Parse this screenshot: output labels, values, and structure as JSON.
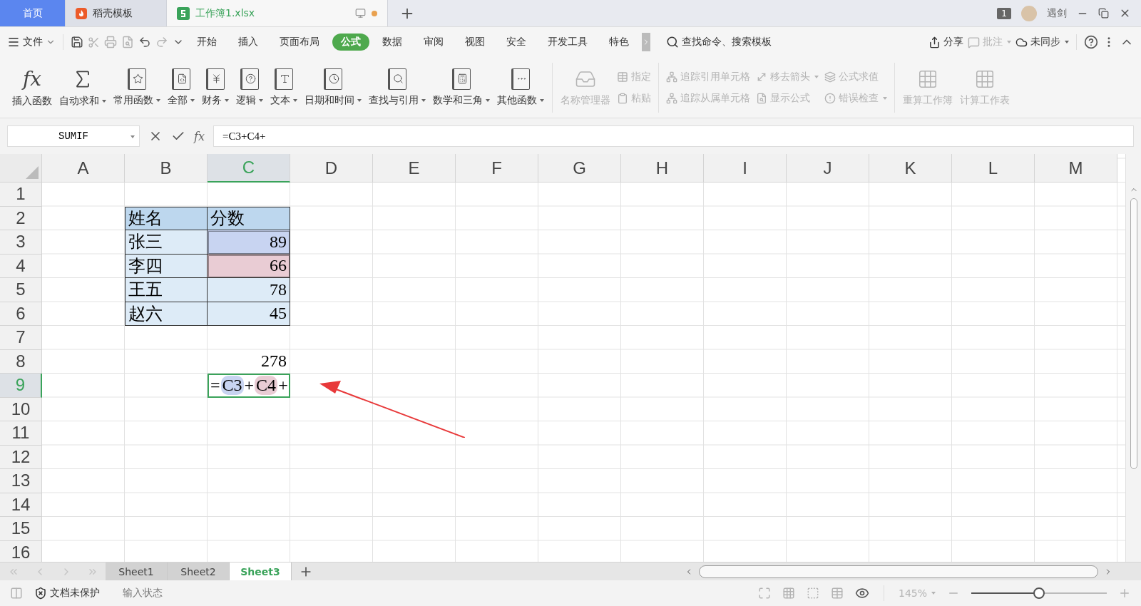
{
  "tabs": [
    {
      "label": "首页",
      "kind": "home",
      "selected": false
    },
    {
      "label": "稻壳模板",
      "kind": "docer",
      "selected": false
    },
    {
      "label": "工作簿1.xlsx",
      "kind": "sheet",
      "selected": true,
      "unsaved": true
    }
  ],
  "title_bar": {
    "badge": "1",
    "user": "遇剑"
  },
  "menu": {
    "file": "文件",
    "items": [
      {
        "label": "开始",
        "selected": false
      },
      {
        "label": "插入",
        "selected": false
      },
      {
        "label": "页面布局",
        "selected": false
      },
      {
        "label": "公式",
        "selected": true
      },
      {
        "label": "数据",
        "selected": false
      },
      {
        "label": "审阅",
        "selected": false
      },
      {
        "label": "视图",
        "selected": false
      },
      {
        "label": "安全",
        "selected": false
      },
      {
        "label": "开发工具",
        "selected": false
      },
      {
        "label": "特色",
        "selected": false
      }
    ],
    "search": "查找命令、搜索模板",
    "share": "分享",
    "comment": "批注",
    "sync": "未同步"
  },
  "ribbon": {
    "functions": [
      {
        "label": "插入函数",
        "kind": "fx",
        "glyph": "fx",
        "dropdown": false
      },
      {
        "label": "自动求和",
        "kind": "sigma",
        "dropdown": true
      },
      {
        "label": "常用函数",
        "kind": "star",
        "dropdown": true
      },
      {
        "label": "全部",
        "kind": "all",
        "dropdown": true
      },
      {
        "label": "财务",
        "kind": "yen",
        "dropdown": true
      },
      {
        "label": "逻辑",
        "kind": "help",
        "dropdown": true
      },
      {
        "label": "文本",
        "kind": "text",
        "dropdown": true
      },
      {
        "label": "日期和时间",
        "kind": "clock",
        "dropdown": true
      },
      {
        "label": "查找与引用",
        "kind": "search",
        "dropdown": true
      },
      {
        "label": "数学和三角",
        "kind": "math",
        "dropdown": true
      },
      {
        "label": "其他函数",
        "kind": "more",
        "dropdown": true
      }
    ],
    "names": {
      "big": {
        "label": "名称管理器",
        "disabled": true
      },
      "small": [
        {
          "label": "指定",
          "disabled": true
        },
        {
          "label": "粘贴",
          "disabled": true
        }
      ]
    },
    "audit": [
      {
        "label": "追踪引用单元格",
        "kind": "trace",
        "disabled": true,
        "dropdown": false
      },
      {
        "label": "追踪从属单元格",
        "kind": "dependents",
        "disabled": true,
        "dropdown": false
      },
      {
        "label": "移去箭头",
        "kind": "remove",
        "disabled": true,
        "dropdown": true
      },
      {
        "label": "显示公式",
        "kind": "show",
        "disabled": true,
        "dropdown": false
      },
      {
        "label": "公式求值",
        "kind": "evaluate",
        "disabled": true,
        "dropdown": false
      },
      {
        "label": "错误检查",
        "kind": "error",
        "disabled": true,
        "dropdown": true
      }
    ],
    "calc": [
      {
        "label": "重算工作簿",
        "disabled": true
      },
      {
        "label": "计算工作表",
        "disabled": true
      }
    ]
  },
  "formula_bar": {
    "name_box": "SUMIF",
    "fx": "fx",
    "formula": "=C3+C4+"
  },
  "sheet": {
    "columns": [
      {
        "label": "A",
        "selected": false
      },
      {
        "label": "B",
        "selected": false
      },
      {
        "label": "C",
        "selected": true
      },
      {
        "label": "D",
        "selected": false
      },
      {
        "label": "E",
        "selected": false
      },
      {
        "label": "F",
        "selected": false
      },
      {
        "label": "G",
        "selected": false
      },
      {
        "label": "H",
        "selected": false
      },
      {
        "label": "I",
        "selected": false
      },
      {
        "label": "J",
        "selected": false
      },
      {
        "label": "K",
        "selected": false
      },
      {
        "label": "L",
        "selected": false
      },
      {
        "label": "M",
        "selected": false
      }
    ],
    "rows": [
      {
        "label": "1",
        "selected": false
      },
      {
        "label": "2",
        "selected": false,
        "cells": {
          "B": {
            "kind": "head",
            "text": "姓名"
          },
          "C": {
            "kind": "head",
            "text": "分数"
          }
        }
      },
      {
        "label": "3",
        "selected": false,
        "cells": {
          "B": {
            "kind": "label",
            "text": "张三"
          },
          "C": {
            "kind": "value",
            "text": "89",
            "color": "#c8d4f1"
          }
        }
      },
      {
        "label": "4",
        "selected": false,
        "cells": {
          "B": {
            "kind": "label",
            "text": "李四"
          },
          "C": {
            "kind": "value",
            "text": "66",
            "color": "#e9ccd4"
          }
        }
      },
      {
        "label": "5",
        "selected": false,
        "cells": {
          "B": {
            "kind": "label",
            "text": "王五"
          },
          "C": {
            "kind": "value",
            "text": "78"
          }
        }
      },
      {
        "label": "6",
        "selected": false,
        "cells": {
          "B": {
            "kind": "label",
            "text": "赵六"
          },
          "C": {
            "kind": "value",
            "text": "45"
          }
        }
      },
      {
        "label": "7",
        "selected": false
      },
      {
        "label": "8",
        "selected": false,
        "cells": {
          "C": {
            "kind": "plain",
            "text": "278"
          }
        }
      },
      {
        "label": "9",
        "selected": true,
        "cells": {
          "C": {
            "kind": "editing",
            "parts": [
              {
                "text": "="
              },
              {
                "text": "C3",
                "color": "#c8d4f1"
              },
              {
                "text": "+"
              },
              {
                "text": "C4",
                "color": "#e9ccd4"
              },
              {
                "text": "+"
              }
            ]
          }
        }
      },
      {
        "label": "10",
        "selected": false
      },
      {
        "label": "11",
        "selected": false
      },
      {
        "label": "12",
        "selected": false
      },
      {
        "label": "13",
        "selected": false
      },
      {
        "label": "14",
        "selected": false
      },
      {
        "label": "15",
        "selected": false
      },
      {
        "label": "16",
        "selected": false
      }
    ],
    "annotation_arrow": true
  },
  "sheet_tabs": [
    {
      "label": "Sheet1",
      "selected": false
    },
    {
      "label": "Sheet2",
      "selected": false
    },
    {
      "label": "Sheet3",
      "selected": true
    }
  ],
  "status_bar": {
    "protection": "文档未保护",
    "mode": "输入状态",
    "zoom": "145%",
    "zoom_level": {
      "level": 0.5
    }
  }
}
